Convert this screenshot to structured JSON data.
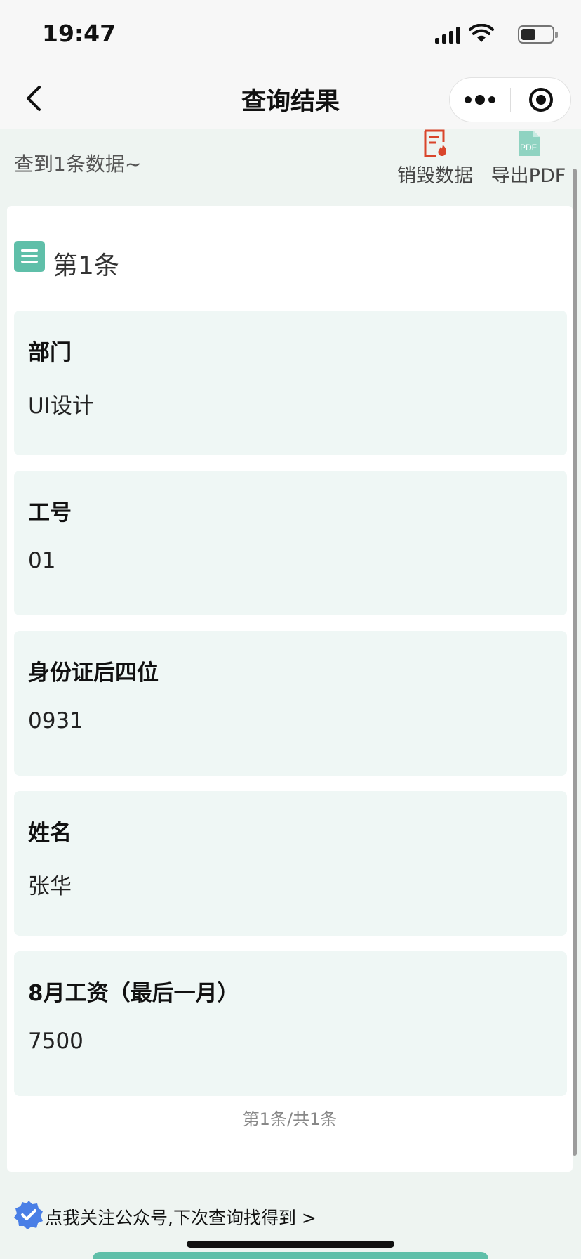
{
  "status_bar": {
    "time": "19:47"
  },
  "nav": {
    "title": "查询结果"
  },
  "header": {
    "found_text": "查到1条数据~",
    "actions": {
      "destroy_label": "销毁数据",
      "export_label": "导出PDF",
      "pdf_icon_text": "PDF"
    }
  },
  "record": {
    "title": "第1条",
    "fields": [
      {
        "label": "部门",
        "value": "UI设计"
      },
      {
        "label": "工号",
        "value": "01"
      },
      {
        "label": "身份证后四位",
        "value": "0931"
      },
      {
        "label": "姓名",
        "value": "张华"
      },
      {
        "label": "8月工资（最后一月）",
        "value": "7500"
      }
    ]
  },
  "pager": {
    "text": "第1条/共1条"
  },
  "footer": {
    "follow_text": "点我关注公众号,下次查询找得到 >"
  },
  "colors": {
    "accent": "#5fbfa9",
    "danger": "#d9452b",
    "field_bg": "#eff7f5"
  }
}
